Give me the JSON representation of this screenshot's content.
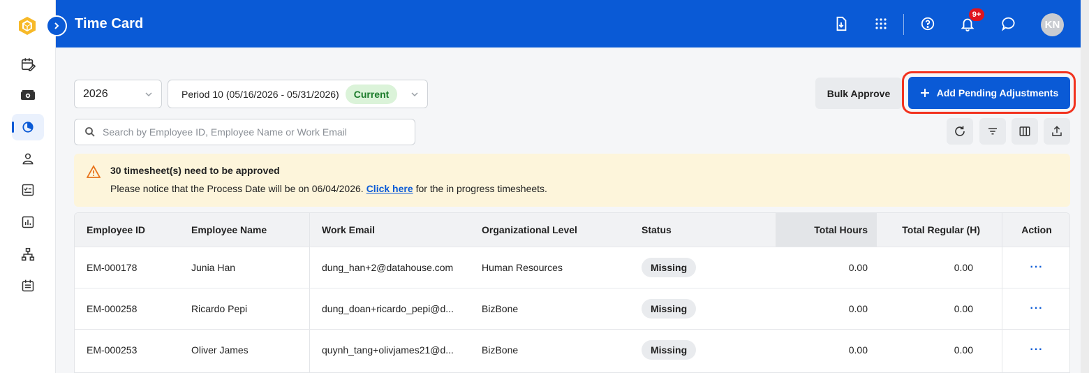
{
  "header": {
    "title": "Time Card",
    "notification_count": "9+",
    "avatar_initials": "KN"
  },
  "filters": {
    "year": "2026",
    "period": "Period 10 (05/16/2026 - 05/31/2026)",
    "period_badge": "Current"
  },
  "actions": {
    "bulk_approve": "Bulk Approve",
    "add_pending": "Add Pending Adjustments"
  },
  "search": {
    "placeholder": "Search by Employee ID, Employee Name or Work Email"
  },
  "alert": {
    "title": "30 timesheet(s) need to be approved",
    "message_prefix": "Please notice that the Process Date will be on 06/04/2026.",
    "link": "Click here",
    "message_suffix": "for the in progress timesheets."
  },
  "table": {
    "columns": {
      "employee_id": "Employee ID",
      "employee_name": "Employee Name",
      "work_email": "Work Email",
      "org_level": "Organizational Level",
      "status": "Status",
      "total_hours": "Total Hours",
      "total_regular": "Total Regular (H)",
      "action": "Action"
    },
    "rows": [
      {
        "id": "EM-000178",
        "name": "Junia Han",
        "email": "dung_han+2@datahouse.com",
        "org": "Human Resources",
        "status": "Missing",
        "hours": "0.00",
        "regular": "0.00",
        "action": "···"
      },
      {
        "id": "EM-000258",
        "name": "Ricardo Pepi",
        "email": "dung_doan+ricardo_pepi@d...",
        "org": "BizBone",
        "status": "Missing",
        "hours": "0.00",
        "regular": "0.00",
        "action": "···"
      },
      {
        "id": "EM-000253",
        "name": "Oliver James",
        "email": "quynh_tang+olivjames21@d...",
        "org": "BizBone",
        "status": "Missing",
        "hours": "0.00",
        "regular": "0.00",
        "action": "···"
      }
    ]
  },
  "icons": {
    "logo": "hexagon-cube-logo",
    "nav": [
      "calendar-edit-icon",
      "money-icon",
      "timer-icon",
      "person-icon",
      "checklist-icon",
      "chart-icon",
      "org-chart-icon",
      "schedule-icon"
    ]
  },
  "colors": {
    "primary": "#0a5ad6",
    "highlight_ring": "#f2331f",
    "alert_bg": "#fdf5db",
    "badge_green": "#dbf3d9"
  }
}
